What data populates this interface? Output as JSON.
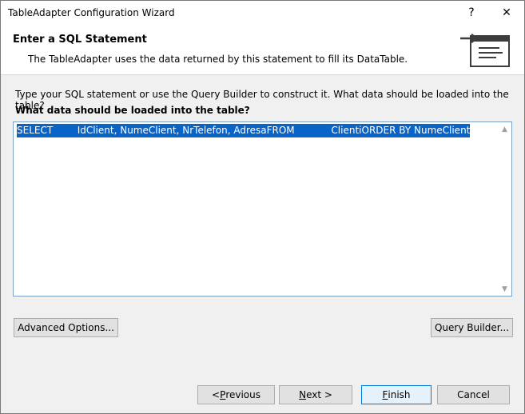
{
  "window": {
    "title": "TableAdapter Configuration Wizard",
    "help_label": "?",
    "close_label": "✕"
  },
  "header": {
    "title": "Enter a SQL Statement",
    "description": "The TableAdapter uses the data returned by this statement to fill its DataTable."
  },
  "main": {
    "instruction": "Type your SQL statement or use the Query Builder to construct it. What data should be loaded into the table?",
    "question": "What data should be loaded into the table?",
    "sql_text": "SELECT        IdClient, NumeClient, NrTelefon, AdresaFROM            ClientiORDER BY NumeClient"
  },
  "buttons": {
    "advanced_options": "Advanced Options...",
    "query_builder": "Query Builder...",
    "previous_prefix": "< ",
    "previous_mnemonic": "P",
    "previous_rest": "revious",
    "next_mnemonic": "N",
    "next_rest": "ext >",
    "finish_mnemonic": "F",
    "finish_rest": "inish",
    "cancel": "Cancel"
  },
  "colors": {
    "selection": "#0a64c8",
    "focus_border": "#0078d7"
  }
}
